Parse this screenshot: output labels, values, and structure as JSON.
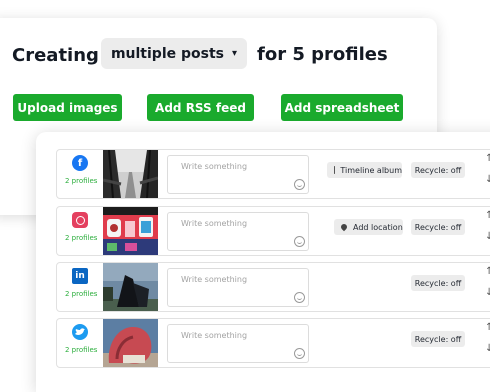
{
  "header": {
    "title_prefix": "Creating",
    "mode_dropdown": {
      "selected": "multiple posts",
      "caret": "▾"
    },
    "title_suffix": "for 5 profiles"
  },
  "actions": {
    "upload_images": "Upload images",
    "add_rss_feed": "Add RSS feed",
    "add_spreadsheet": "Add spreadsheet"
  },
  "colors": {
    "primary_green": "#1aaa2d",
    "profiles_green": "#2cae3d"
  },
  "posts": [
    {
      "network_icon": "facebook-icon",
      "profiles": "2 profiles",
      "placeholder": "Write something",
      "option": "Timeline album",
      "option_icon": "album-icon",
      "recycle": "Recycle: off",
      "up": "↑",
      "down": "↓"
    },
    {
      "network_icon": "instagram-icon",
      "profiles": "2 profiles",
      "placeholder": "Write something",
      "option": "Add location",
      "option_icon": "location-pin-icon",
      "recycle": "Recycle: off",
      "up": "↑",
      "down": "↓"
    },
    {
      "network_icon": "linkedin-icon",
      "profiles": "2 profiles",
      "placeholder": "Write something",
      "recycle": "Recycle: off",
      "up": "↑",
      "down": "↓"
    },
    {
      "network_icon": "twitter-icon",
      "profiles": "2 profiles",
      "placeholder": "Write something",
      "recycle": "Recycle: off",
      "up": "↑",
      "down": "↓"
    }
  ]
}
